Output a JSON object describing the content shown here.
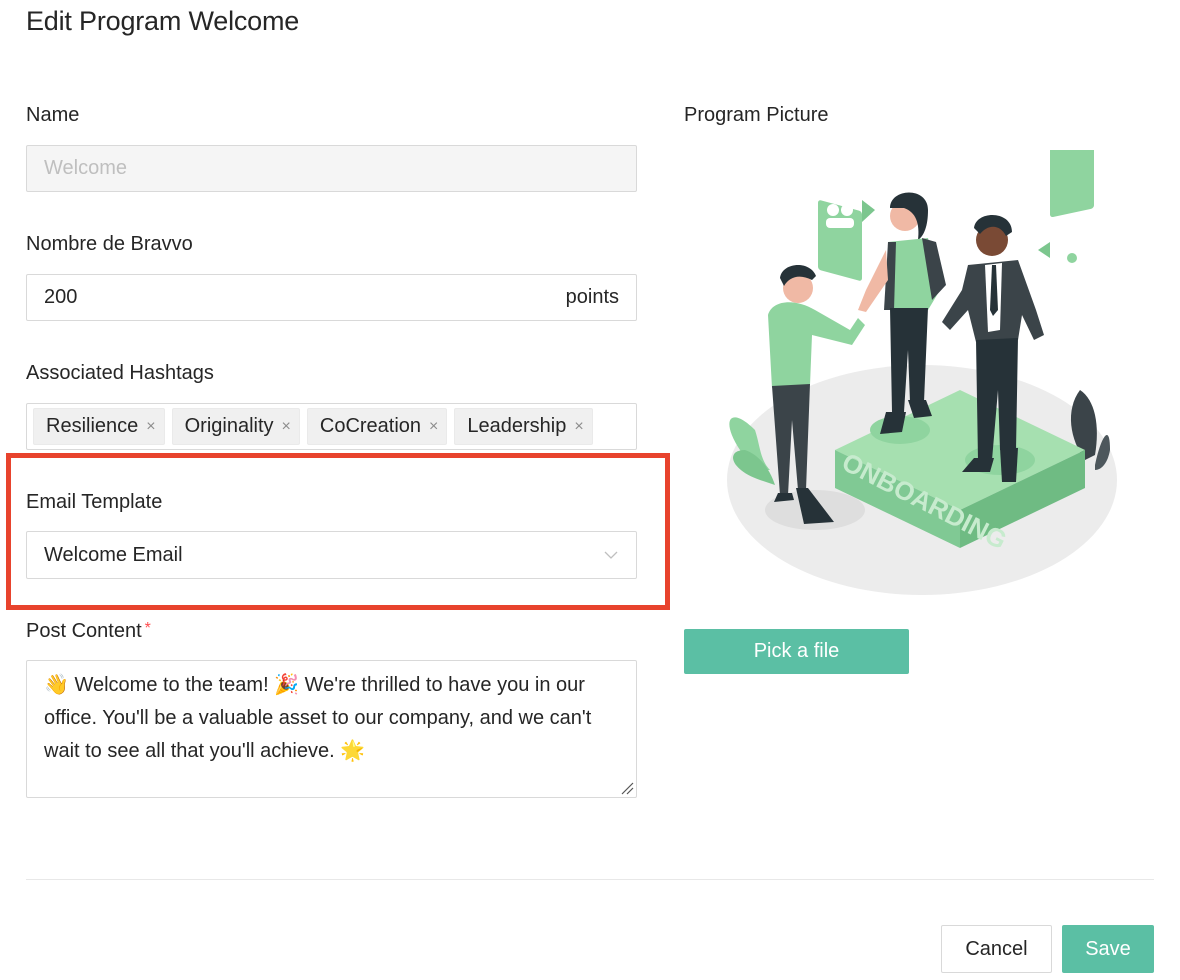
{
  "page": {
    "title": "Edit Program Welcome"
  },
  "form": {
    "name": {
      "label": "Name",
      "value": "Welcome"
    },
    "bravvo": {
      "label": "Nombre de Bravvo",
      "value": "200",
      "suffix": "points"
    },
    "hashtags": {
      "label": "Associated Hashtags",
      "items": [
        "Resilience",
        "Originality",
        "CoCreation",
        "Leadership"
      ],
      "remove_glyph": "×"
    },
    "email_template": {
      "label": "Email Template",
      "value": "Welcome Email"
    },
    "post_content": {
      "label": "Post Content",
      "required_mark": "*",
      "value": "👋 Welcome to the team! 🎉 We're thrilled to have you in our office. You'll be a valuable asset to our company, and we can't wait to see all that you'll achieve. 🌟"
    }
  },
  "picture": {
    "label": "Program Picture",
    "image_text": "ONBOARDING",
    "pick_label": "Pick a file"
  },
  "footer": {
    "cancel_label": "Cancel",
    "save_label": "Save"
  },
  "colors": {
    "accent": "#5bbfa4",
    "highlight": "#e8432d",
    "illustration_green": "#8fd49f"
  }
}
